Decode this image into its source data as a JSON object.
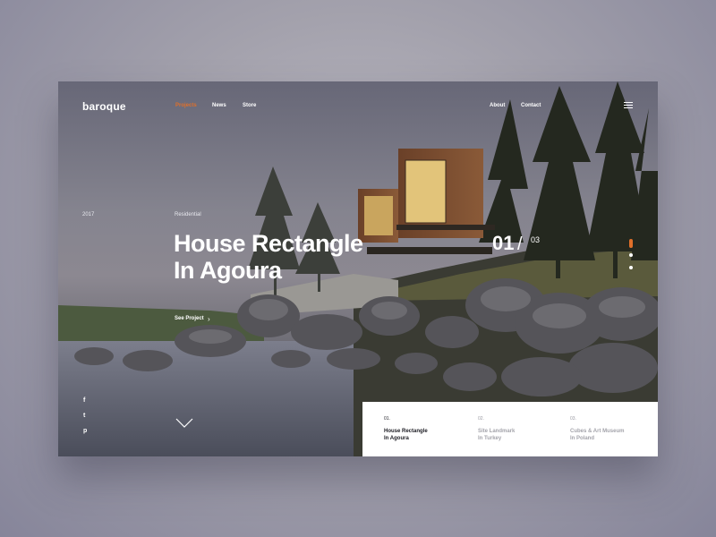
{
  "app": {
    "logo": "baroque"
  },
  "nav": {
    "left": [
      {
        "label": "Projects",
        "active": true
      },
      {
        "label": "News",
        "active": false
      },
      {
        "label": "Store",
        "active": false
      }
    ],
    "right": [
      {
        "label": "About"
      },
      {
        "label": "Contact"
      }
    ],
    "menu_icon": "hamburger-menu-icon"
  },
  "hero": {
    "year": "2017",
    "category": "Residential",
    "title_line1": "House Rectangle",
    "title_line2": "In Agoura",
    "cta_label": "See Project",
    "cta_icon": "chevron-right-icon"
  },
  "counter": {
    "current": "01",
    "separator": "/",
    "total": "03"
  },
  "slider_dots": {
    "count": 3,
    "active_index": 0
  },
  "social": [
    {
      "icon": "facebook-icon",
      "glyph": "f"
    },
    {
      "icon": "twitter-icon",
      "glyph": "t"
    },
    {
      "icon": "pinterest-icon",
      "glyph": "p"
    }
  ],
  "scroll_icon": "chevron-down-icon",
  "slides": [
    {
      "num": "01.",
      "line1": "House Rectangle",
      "line2": "In Agoura",
      "current": true
    },
    {
      "num": "02.",
      "line1": "Site Landmark",
      "line2": "In Turkey",
      "current": false
    },
    {
      "num": "03.",
      "line1": "Cubes & Art Museum",
      "line2": "In Poland",
      "current": false
    }
  ],
  "colors": {
    "accent": "#e0702a",
    "text_dark": "#1b1b22",
    "text_muted": "#a4a4ab",
    "card_bg": "#ffffff"
  }
}
